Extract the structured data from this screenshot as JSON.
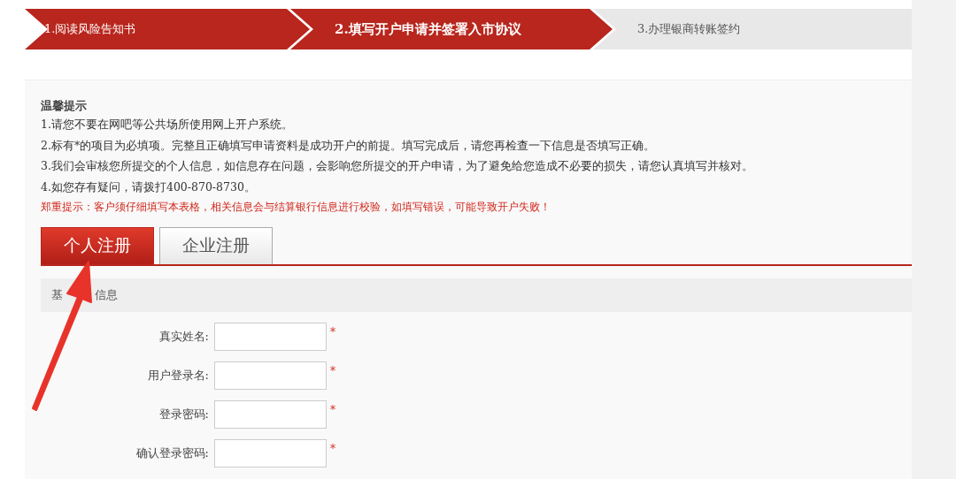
{
  "steps": [
    {
      "label": "1.阅读风险告知书",
      "reached": true,
      "selected": false
    },
    {
      "label": "2.填写开户申请并签署入市协议",
      "reached": true,
      "selected": true
    },
    {
      "label": "3.办理银商转账签约",
      "reached": false,
      "selected": false
    }
  ],
  "notice": {
    "title": "温馨提示",
    "lines": [
      {
        "text": "1.请您不要在网吧等公共场所使用网上开户系统。",
        "kind": "normal"
      },
      {
        "text": "2.标有*的项目为必填项。完整且正确填写申请资料是成功开户的前提。填写完成后，请您再检查一下信息是否填写正确。",
        "kind": "normal"
      },
      {
        "text": "3.我们会审核您所提交的个人信息，如信息存在问题，会影响您所提交的开户申请，为了避免给您造成不必要的损失，请您认真填写并核对。",
        "kind": "normal"
      },
      {
        "text": "4.如您存有疑问，请拨打400-870-8730。",
        "kind": "normal"
      },
      {
        "text": "郑重提示：客户须仔细填写本表格，相关信息会与结算银行信息进行校验，如填写错误，可能导致开户失败！",
        "kind": "warning"
      }
    ]
  },
  "tabs": [
    {
      "label": "个人注册",
      "selected": true
    },
    {
      "label": "企业注册",
      "selected": false
    }
  ],
  "section": {
    "title_parts": [
      "基",
      "信息"
    ]
  },
  "fields": [
    {
      "label": "真实姓名:",
      "required_mark": "*"
    },
    {
      "label": "用户登录名:",
      "required_mark": "*"
    },
    {
      "label": "登录密码:",
      "required_mark": "*"
    },
    {
      "label": "确认登录密码:",
      "required_mark": "*"
    }
  ],
  "annotation": {
    "kind": "arrow"
  }
}
